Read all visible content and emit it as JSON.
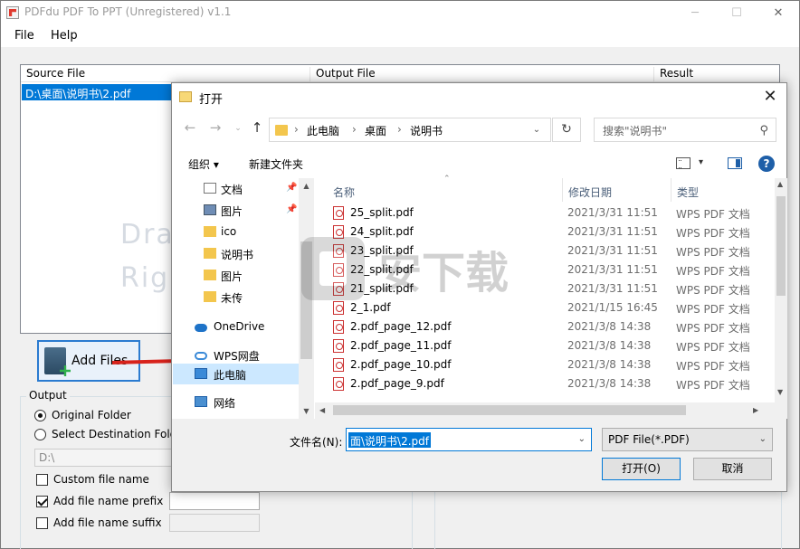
{
  "app": {
    "title": "PDFdu PDF To PPT (Unregistered) v1.1",
    "menu": [
      "File",
      "Help"
    ],
    "columns": [
      "Source File",
      "Output File",
      "Result"
    ],
    "selected_row": "D:\\桌面\\说明书\\2.pdf",
    "drag_hint_1": "Dra",
    "drag_hint_2": "Righ",
    "add_files": "Add Files",
    "output": {
      "legend": "Output",
      "original_folder": "Original Folder",
      "select_dest": "Select Destination Folde",
      "dest_value": "D:\\",
      "custom_name": "Custom file name",
      "prefix": "Add file name prefix",
      "suffix": "Add file name suffix"
    }
  },
  "dialog": {
    "title": "打开",
    "breadcrumb": [
      "此电脑",
      "桌面",
      "说明书"
    ],
    "search_placeholder": "搜索\"说明书\"",
    "organize": "组织 ▾",
    "new_folder": "新建文件夹",
    "nav": [
      {
        "label": "文档",
        "pinned": true,
        "icon": "document-icon"
      },
      {
        "label": "图片",
        "pinned": true,
        "icon": "picture-icon"
      },
      {
        "label": "ico",
        "pinned": false,
        "icon": "folder-icon"
      },
      {
        "label": "说明书",
        "pinned": false,
        "icon": "folder-icon"
      },
      {
        "label": "图片",
        "pinned": false,
        "icon": "folder-icon"
      },
      {
        "label": "未传",
        "pinned": false,
        "icon": "folder-icon"
      },
      {
        "label": "OneDrive",
        "pinned": false,
        "icon": "cloud-icon"
      },
      {
        "label": "WPS网盘",
        "pinned": false,
        "icon": "wps-cloud-icon"
      },
      {
        "label": "此电脑",
        "pinned": false,
        "icon": "computer-icon",
        "selected": true
      },
      {
        "label": "网络",
        "pinned": false,
        "icon": "network-icon"
      }
    ],
    "headers": {
      "name": "名称",
      "date": "修改日期",
      "type": "类型"
    },
    "files": [
      {
        "name": "25_split.pdf",
        "date": "2021/3/31 11:51",
        "type": "WPS PDF 文档"
      },
      {
        "name": "24_split.pdf",
        "date": "2021/3/31 11:51",
        "type": "WPS PDF 文档"
      },
      {
        "name": "23_split.pdf",
        "date": "2021/3/31 11:51",
        "type": "WPS PDF 文档"
      },
      {
        "name": "22_split.pdf",
        "date": "2021/3/31 11:51",
        "type": "WPS PDF 文档"
      },
      {
        "name": "21_split.pdf",
        "date": "2021/3/31 11:51",
        "type": "WPS PDF 文档"
      },
      {
        "name": "2_1.pdf",
        "date": "2021/1/15 16:45",
        "type": "WPS PDF 文档"
      },
      {
        "name": "2.pdf_page_12.pdf",
        "date": "2021/3/8 14:38",
        "type": "WPS PDF 文档"
      },
      {
        "name": "2.pdf_page_11.pdf",
        "date": "2021/3/8 14:38",
        "type": "WPS PDF 文档"
      },
      {
        "name": "2.pdf_page_10.pdf",
        "date": "2021/3/8 14:38",
        "type": "WPS PDF 文档"
      },
      {
        "name": "2.pdf_page_9.pdf",
        "date": "2021/3/8 14:38",
        "type": "WPS PDF 文档"
      }
    ],
    "filename_label": "文件名(N):",
    "filename_value": "面\\说明书\\2.pdf",
    "filetype": "PDF File(*.PDF)",
    "open": "打开(O)",
    "cancel": "取消"
  },
  "watermark": "安下载"
}
